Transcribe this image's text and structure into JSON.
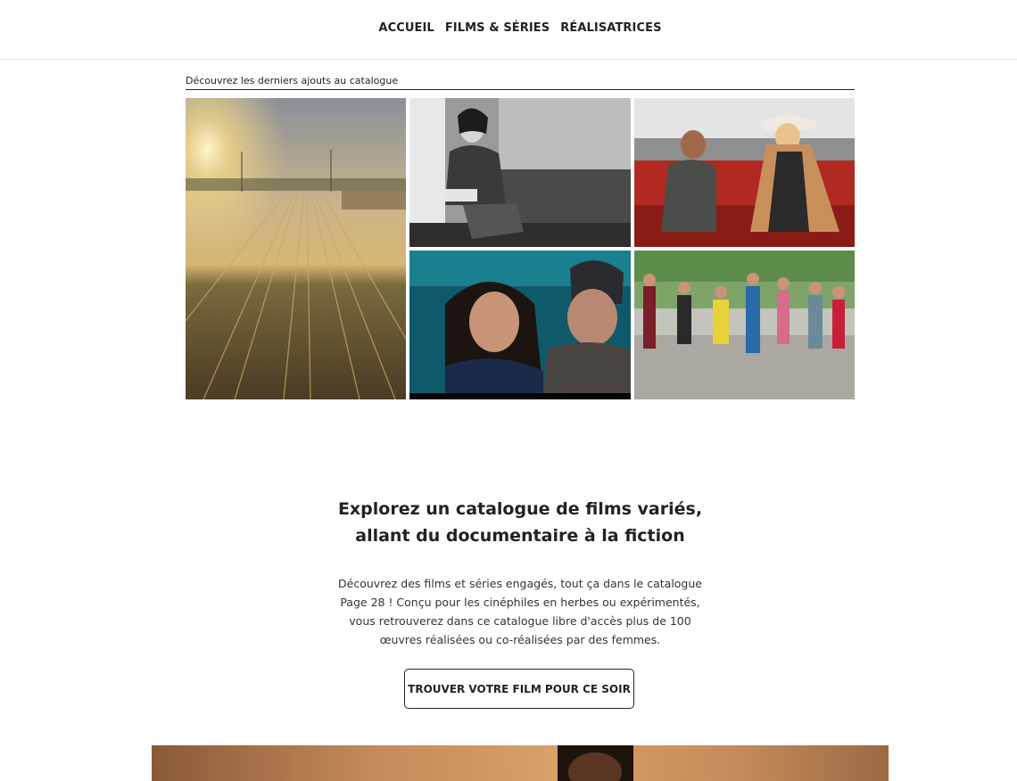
{
  "nav": {
    "items": [
      "ACCUEIL",
      "FILMS & SÉRIES",
      "RÉALISATRICES"
    ]
  },
  "catalog": {
    "label": "Découvrez les derniers ajouts au catalogue"
  },
  "thumbnails": [
    {
      "icon": "railway-sunset-image"
    },
    {
      "icon": "woman-window-bw-image"
    },
    {
      "icon": "couple-red-car-image"
    },
    {
      "icon": "two-women-portrait-image"
    },
    {
      "icon": "street-dancers-image"
    }
  ],
  "intro": {
    "heading_line1": "Explorez un catalogue de films variés,",
    "heading_line2": "allant du documentaire à la fiction",
    "description": "Découvrez des films et séries engagés, tout ça dans le catalogue Page 28 ! Conçu pour les cinéphiles en herbes ou expérimentés, vous retrouverez dans ce catalogue libre d'accès plus de 100 œuvres réalisées ou co-réalisées par des femmes.",
    "cta_label": "TROUVER VOTRE FILM POUR CE SOIR"
  },
  "colors": {
    "text": "#222222",
    "border": "#222222"
  }
}
